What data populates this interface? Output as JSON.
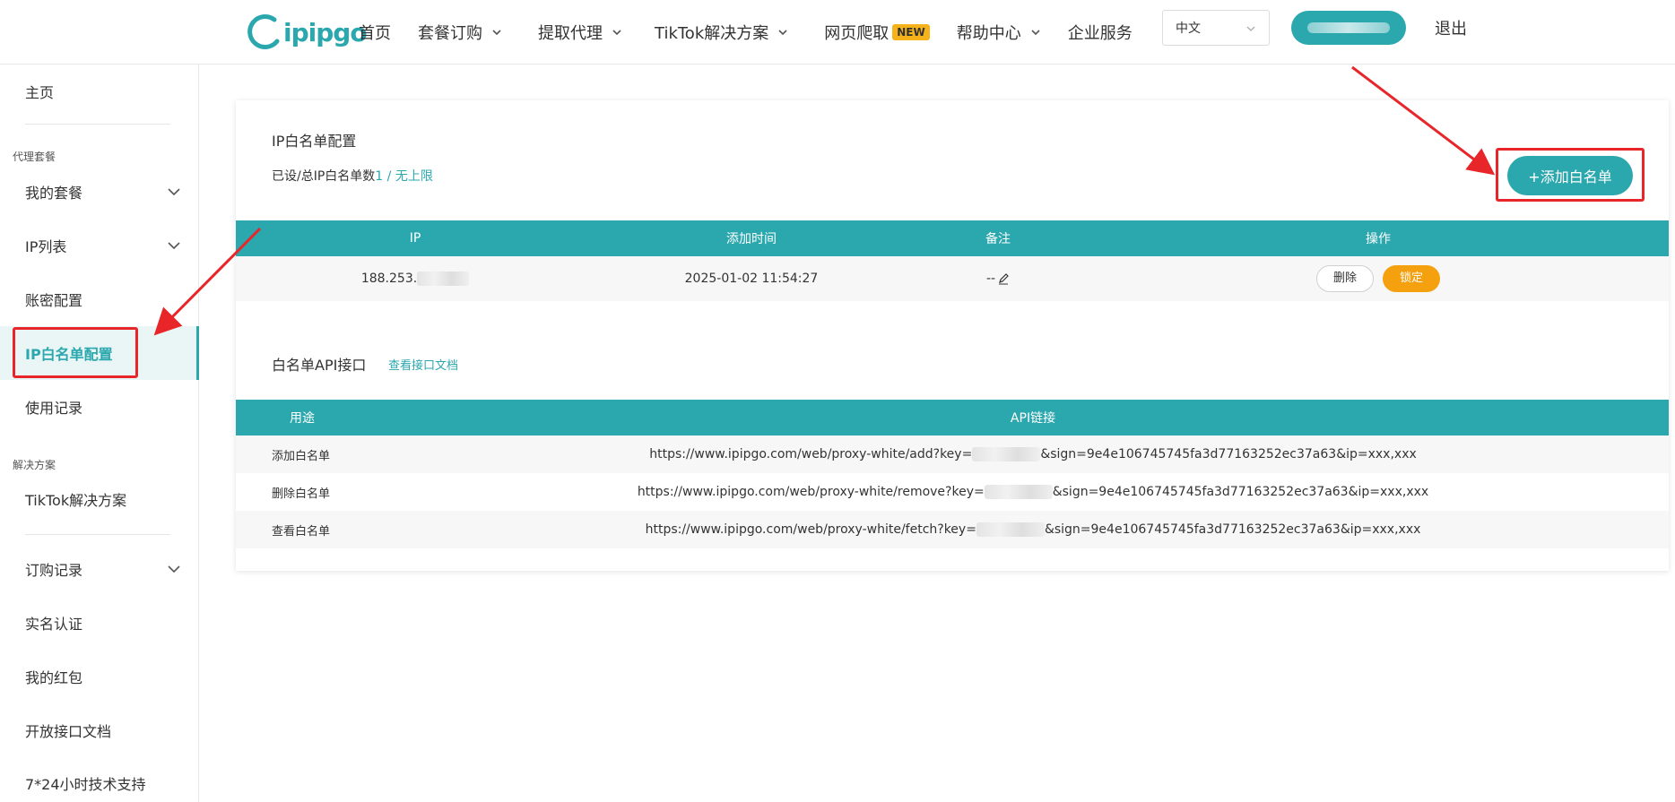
{
  "header": {
    "logo": "ipipgo",
    "nav": [
      {
        "label": "首页",
        "has_dropdown": false
      },
      {
        "label": "套餐订购",
        "has_dropdown": true
      },
      {
        "label": "提取代理",
        "has_dropdown": true
      },
      {
        "label": "TikTok解决方案",
        "has_dropdown": true
      },
      {
        "label": "网页爬取",
        "has_dropdown": false,
        "badge": "NEW"
      },
      {
        "label": "帮助中心",
        "has_dropdown": true
      },
      {
        "label": "企业服务",
        "has_dropdown": false
      }
    ],
    "language": "中文",
    "logout": "退出"
  },
  "sidebar": {
    "home": "主页",
    "group_proxy": "代理套餐",
    "my_plans": "我的套餐",
    "ip_list": "IP列表",
    "account_config": "账密配置",
    "ip_whitelist": "IP白名单配置",
    "usage": "使用记录",
    "group_solution": "解决方案",
    "tiktok": "TikTok解决方案",
    "orders": "订购记录",
    "realname": "实名认证",
    "redpacket": "我的红包",
    "open_api": "开放接口文档",
    "support": "7*24小时技术支持"
  },
  "whitelist": {
    "title": "IP白名单配置",
    "quota_prefix": "已设/总IP白名单数",
    "quota_value": "1 / 无上限",
    "add_button": "+添加白名单",
    "columns": [
      "IP",
      "添加时间",
      "备注",
      "操作"
    ],
    "rows": [
      {
        "ip": "188.253.",
        "added_at": "2025-01-02 11:54:27",
        "note": "--",
        "delete": "删除",
        "lock": "锁定"
      }
    ]
  },
  "api": {
    "title": "白名单API接口",
    "doc_link": "查看接口文档",
    "columns": [
      "用途",
      "API链接"
    ],
    "rows": [
      {
        "use": "添加白名单",
        "url_prefix": "https://www.ipipgo.com/web/proxy-white/add?key=",
        "url_suffix": "&sign=9e4e106745745fa3d77163252ec37a63&ip=xxx,xxx"
      },
      {
        "use": "删除白名单",
        "url_prefix": "https://www.ipipgo.com/web/proxy-white/remove?key=",
        "url_suffix": "&sign=9e4e106745745fa3d77163252ec37a63&ip=xxx,xxx"
      },
      {
        "use": "查看白名单",
        "url_prefix": "https://www.ipipgo.com/web/proxy-white/fetch?key=",
        "url_suffix": "&sign=9e4e106745745fa3d77163252ec37a63&ip=xxx,xxx"
      }
    ]
  },
  "colors": {
    "accent": "#2ba7ae",
    "lock": "#f5a00f",
    "annotation": "#e8262a",
    "badge": "#f5b21b"
  }
}
